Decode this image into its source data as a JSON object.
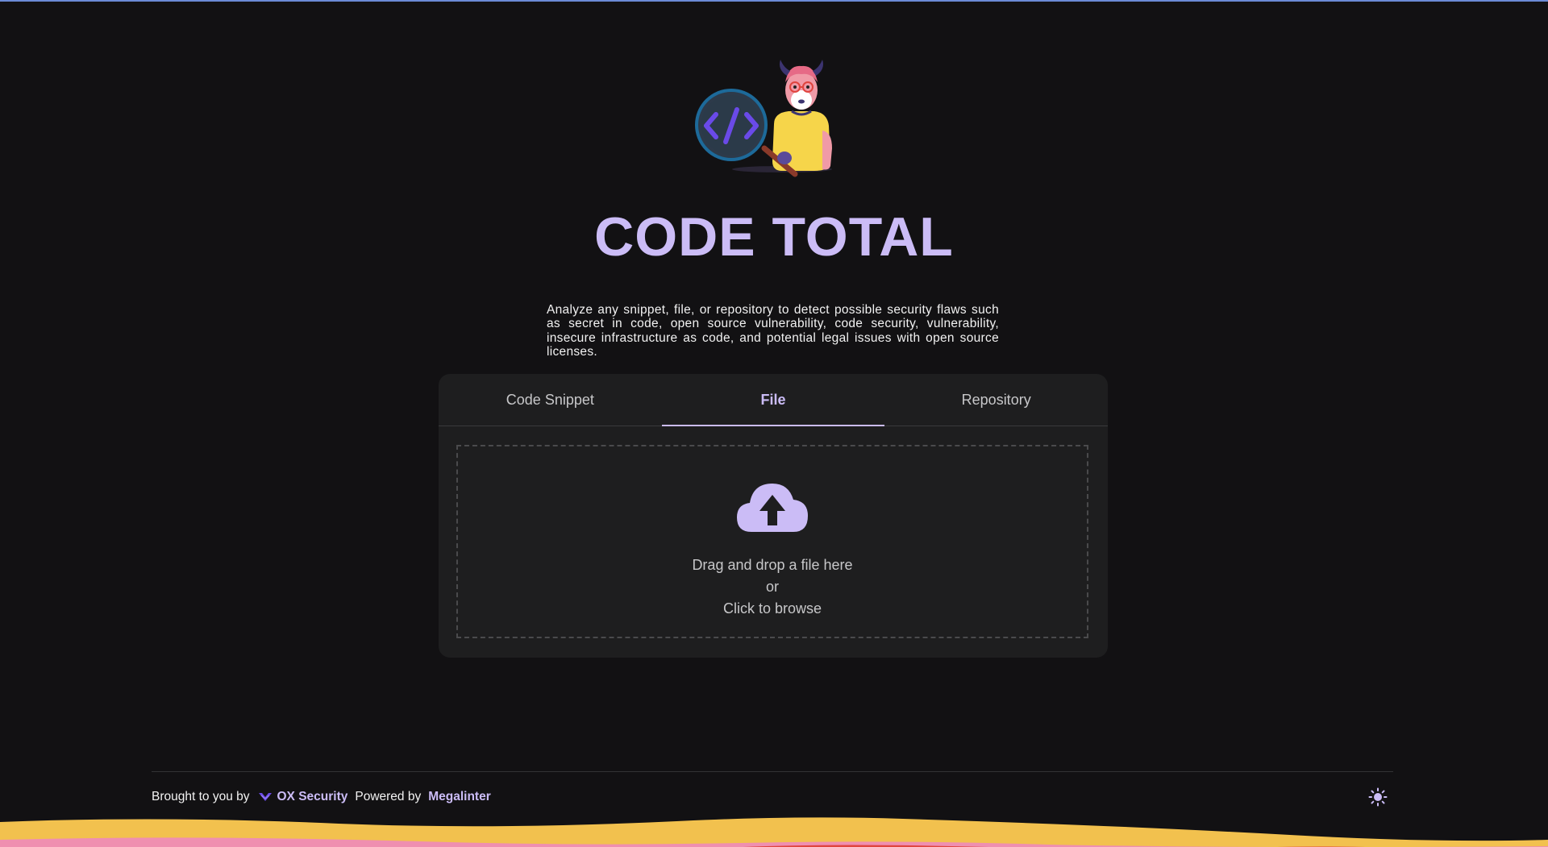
{
  "app": {
    "title": "CODE TOTAL",
    "description": "Analyze any snippet, file, or repository to detect possible security flaws such as secret in code, open source vulnerability, code security, vulnerability, insecure infrastructure as code, and potential legal issues with open source licenses."
  },
  "tabs": [
    {
      "label": "Code Snippet",
      "active": false
    },
    {
      "label": "File",
      "active": true
    },
    {
      "label": "Repository",
      "active": false
    }
  ],
  "dropzone": {
    "icon": "cloud-upload-icon",
    "line1": "Drag and drop a file here",
    "line2": "or",
    "line3": "Click to browse"
  },
  "footer": {
    "brought_by_label": "Brought to you by",
    "ox_logo_icon": "ox-logo-icon",
    "ox_label": "OX Security",
    "powered_by_label": "Powered by",
    "megalinter_label": "Megalinter",
    "theme_icon": "sun-icon"
  },
  "colors": {
    "background": "#121113",
    "accent": "#cbbcf6",
    "card": "#1e1e1f",
    "wave_yellow": "#f2c14e",
    "wave_pink": "#ef8fb0",
    "wave_red": "#e0443e"
  }
}
